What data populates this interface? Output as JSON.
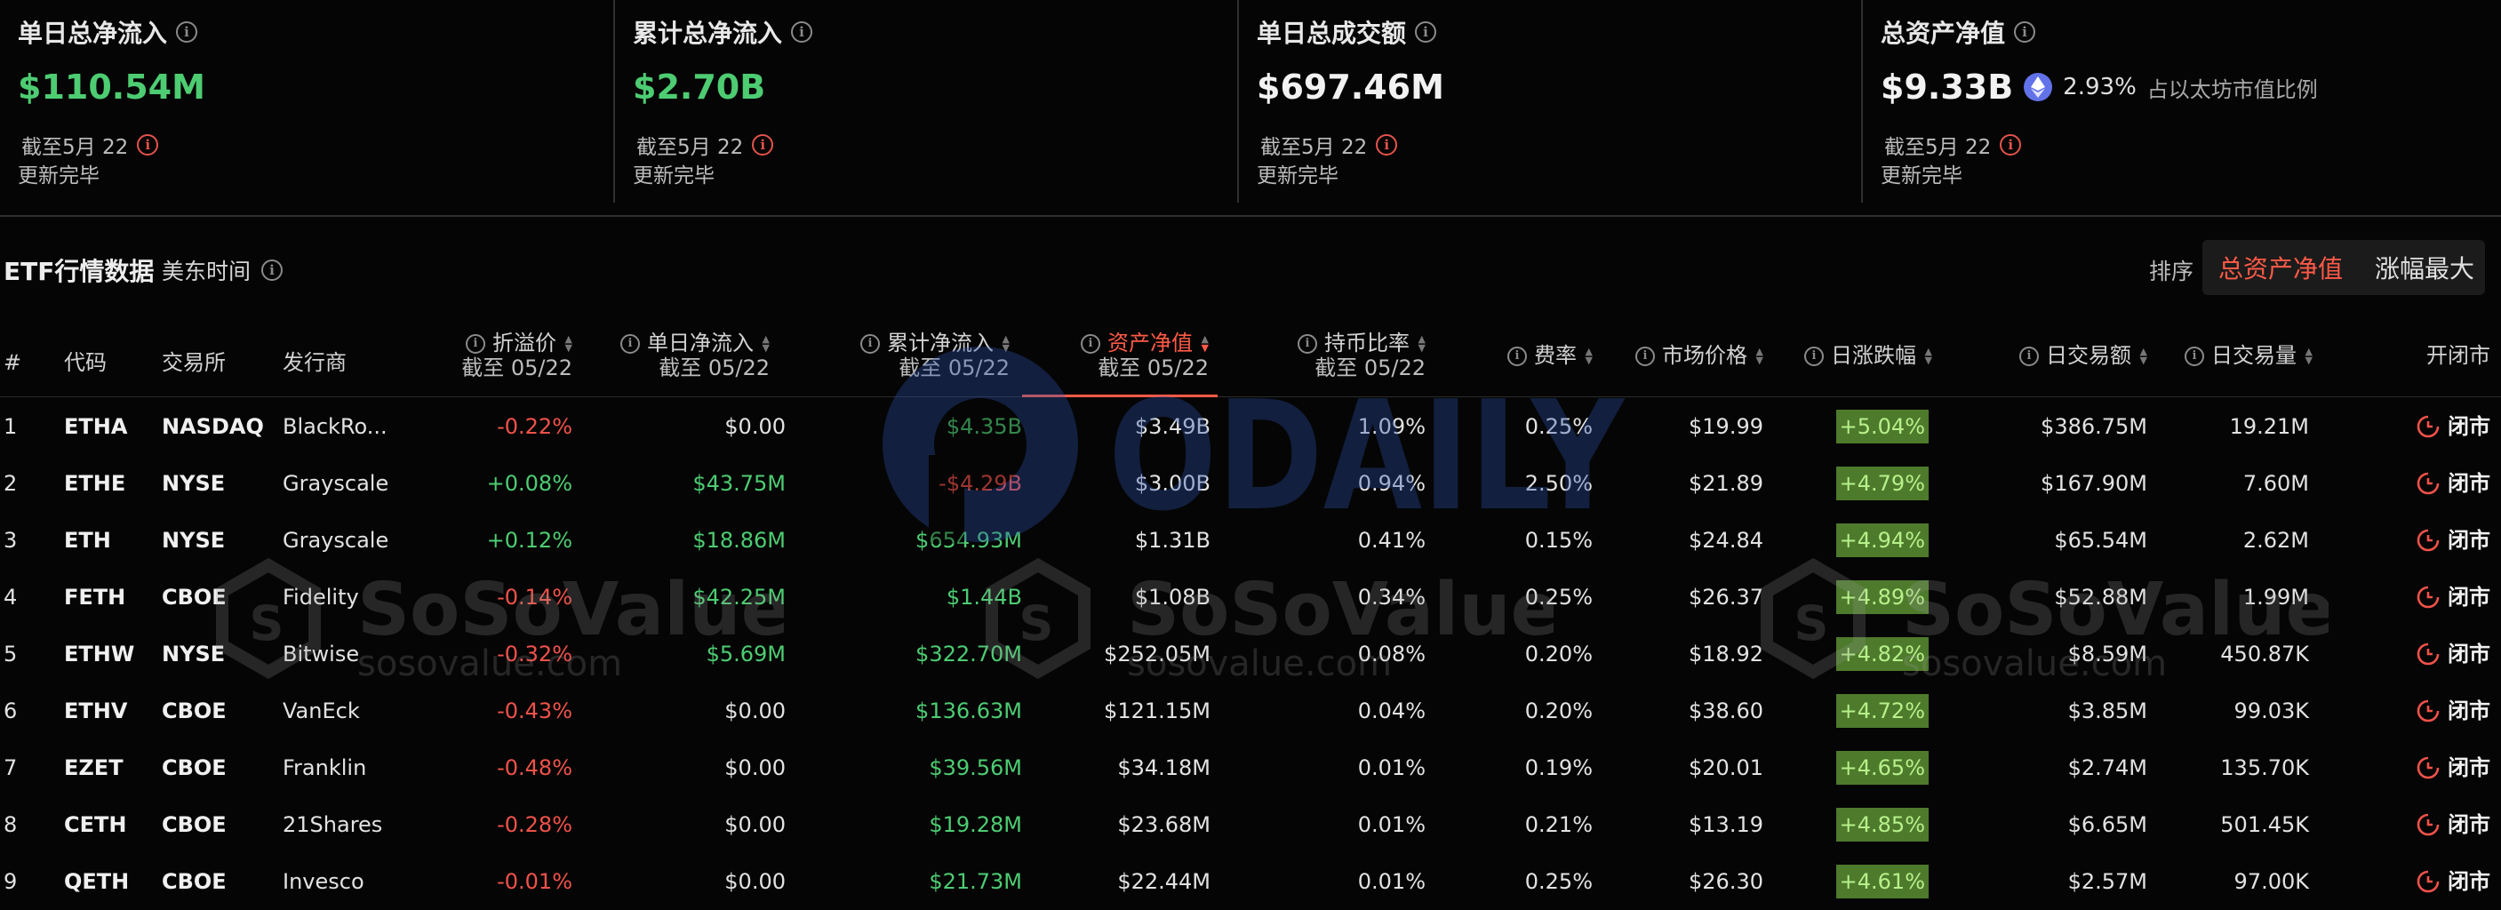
{
  "cards": [
    {
      "title": "单日总净流入",
      "value": "$110.54M",
      "as_of": "截至5月 22",
      "status": "更新完毕"
    },
    {
      "title": "累计总净流入",
      "value": "$2.70B",
      "as_of": "截至5月 22",
      "status": "更新完毕"
    },
    {
      "title": "单日总成交额",
      "value": "$697.46M",
      "as_of": "截至5月 22",
      "status": "更新完毕"
    },
    {
      "title": "总资产净值",
      "value": "$9.33B",
      "ratio": "2.93%",
      "ratio_label": "占以太坊市值比例",
      "as_of": "截至5月 22",
      "status": "更新完毕"
    }
  ],
  "section": {
    "title": "ETF行情数据",
    "timezone": "美东时间",
    "sort_label": "排序",
    "sort_options": [
      "总资产净值",
      "涨幅最大"
    ]
  },
  "columns": {
    "index": "#",
    "code": "代码",
    "exchange": "交易所",
    "issuer": "发行商",
    "premium": "折溢价",
    "premium_sub": "截至 05/22",
    "daily_flow": "单日净流入",
    "daily_flow_sub": "截至 05/22",
    "cum_flow": "累计净流入",
    "cum_flow_sub": "截至 05/22",
    "nav": "资产净值",
    "nav_sub": "截至 05/22",
    "hold_ratio": "持币比率",
    "hold_ratio_sub": "截至 05/22",
    "fee": "费率",
    "price": "市场价格",
    "change": "日涨跌幅",
    "turnover": "日交易额",
    "volume": "日交易量",
    "status": "开闭市"
  },
  "rows": [
    {
      "idx": "1",
      "code": "ETHA",
      "exchange": "NASDAQ",
      "issuer": "BlackRo...",
      "premium": "-0.22%",
      "daily_flow": "$0.00",
      "cum_flow": "$4.35B",
      "nav": "$3.49B",
      "hold_ratio": "1.09%",
      "fee": "0.25%",
      "price": "$19.99",
      "change": "+5.04%",
      "turnover": "$386.75M",
      "volume": "19.21M",
      "status": "闭市"
    },
    {
      "idx": "2",
      "code": "ETHE",
      "exchange": "NYSE",
      "issuer": "Grayscale",
      "premium": "+0.08%",
      "daily_flow": "$43.75M",
      "cum_flow": "-$4.29B",
      "nav": "$3.00B",
      "hold_ratio": "0.94%",
      "fee": "2.50%",
      "price": "$21.89",
      "change": "+4.79%",
      "turnover": "$167.90M",
      "volume": "7.60M",
      "status": "闭市"
    },
    {
      "idx": "3",
      "code": "ETH",
      "exchange": "NYSE",
      "issuer": "Grayscale",
      "premium": "+0.12%",
      "daily_flow": "$18.86M",
      "cum_flow": "$654.93M",
      "nav": "$1.31B",
      "hold_ratio": "0.41%",
      "fee": "0.15%",
      "price": "$24.84",
      "change": "+4.94%",
      "turnover": "$65.54M",
      "volume": "2.62M",
      "status": "闭市"
    },
    {
      "idx": "4",
      "code": "FETH",
      "exchange": "CBOE",
      "issuer": "Fidelity",
      "premium": "-0.14%",
      "daily_flow": "$42.25M",
      "cum_flow": "$1.44B",
      "nav": "$1.08B",
      "hold_ratio": "0.34%",
      "fee": "0.25%",
      "price": "$26.37",
      "change": "+4.89%",
      "turnover": "$52.88M",
      "volume": "1.99M",
      "status": "闭市"
    },
    {
      "idx": "5",
      "code": "ETHW",
      "exchange": "NYSE",
      "issuer": "Bitwise",
      "premium": "-0.32%",
      "daily_flow": "$5.69M",
      "cum_flow": "$322.70M",
      "nav": "$252.05M",
      "hold_ratio": "0.08%",
      "fee": "0.20%",
      "price": "$18.92",
      "change": "+4.82%",
      "turnover": "$8.59M",
      "volume": "450.87K",
      "status": "闭市"
    },
    {
      "idx": "6",
      "code": "ETHV",
      "exchange": "CBOE",
      "issuer": "VanEck",
      "premium": "-0.43%",
      "daily_flow": "$0.00",
      "cum_flow": "$136.63M",
      "nav": "$121.15M",
      "hold_ratio": "0.04%",
      "fee": "0.20%",
      "price": "$38.60",
      "change": "+4.72%",
      "turnover": "$3.85M",
      "volume": "99.03K",
      "status": "闭市"
    },
    {
      "idx": "7",
      "code": "EZET",
      "exchange": "CBOE",
      "issuer": "Franklin",
      "premium": "-0.48%",
      "daily_flow": "$0.00",
      "cum_flow": "$39.56M",
      "nav": "$34.18M",
      "hold_ratio": "0.01%",
      "fee": "0.19%",
      "price": "$20.01",
      "change": "+4.65%",
      "turnover": "$2.74M",
      "volume": "135.70K",
      "status": "闭市"
    },
    {
      "idx": "8",
      "code": "CETH",
      "exchange": "CBOE",
      "issuer": "21Shares",
      "premium": "-0.28%",
      "daily_flow": "$0.00",
      "cum_flow": "$19.28M",
      "nav": "$23.68M",
      "hold_ratio": "0.01%",
      "fee": "0.21%",
      "price": "$13.19",
      "change": "+4.85%",
      "turnover": "$6.65M",
      "volume": "501.45K",
      "status": "闭市"
    },
    {
      "idx": "9",
      "code": "QETH",
      "exchange": "CBOE",
      "issuer": "Invesco",
      "premium": "-0.01%",
      "daily_flow": "$0.00",
      "cum_flow": "$21.73M",
      "nav": "$22.44M",
      "hold_ratio": "0.01%",
      "fee": "0.25%",
      "price": "$26.30",
      "change": "+4.61%",
      "turnover": "$2.57M",
      "volume": "97.00K",
      "status": "闭市"
    }
  ],
  "watermarks": {
    "odaily": "ODAILY",
    "soso_brand": "SoSoValue",
    "soso_url": "sosovalue.com"
  },
  "colors": {
    "positive": "#4dcc72",
    "negative": "#f0524a",
    "accent": "#ff5a47",
    "change_bg": "#4e7a2c",
    "background": "#050505"
  },
  "icons": {
    "info": "info-circle-icon",
    "eth": "ethereum-icon",
    "status": "clock-icon",
    "sort": "sort-arrows-icon"
  }
}
